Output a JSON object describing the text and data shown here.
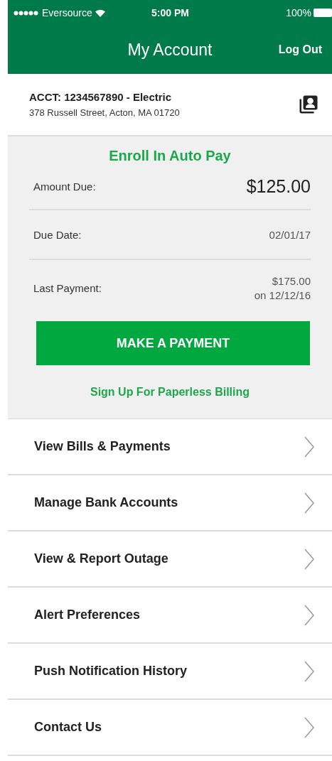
{
  "status_bar": {
    "carrier": "Eversource",
    "time": "5:00 PM",
    "battery": "100%"
  },
  "header": {
    "title": "My Account",
    "action": "Log Out"
  },
  "account": {
    "number": "ACCT: 1234567890 - Electric",
    "address": "378 Russell Street, Acton, MA 01720"
  },
  "summary": {
    "enroll_link": "Enroll In Auto Pay",
    "rows": [
      {
        "kind": "large",
        "label": "Amount Due:",
        "value": [
          "$125.00"
        ]
      },
      {
        "kind": "plain",
        "label": "Due Date:",
        "value": [
          "02/01/17"
        ]
      },
      {
        "kind": "plain",
        "label": "Last Payment:",
        "value": [
          "$175.00",
          "on 12/12/16"
        ]
      }
    ],
    "button": "MAKE A PAYMENT",
    "paperless_link": "Sign Up For Paperless Billing"
  },
  "menu": [
    "View Bills & Payments",
    "Manage Bank Accounts",
    "View & Report Outage",
    "Alert Preferences",
    "Push Notification History",
    "Contact Us"
  ]
}
